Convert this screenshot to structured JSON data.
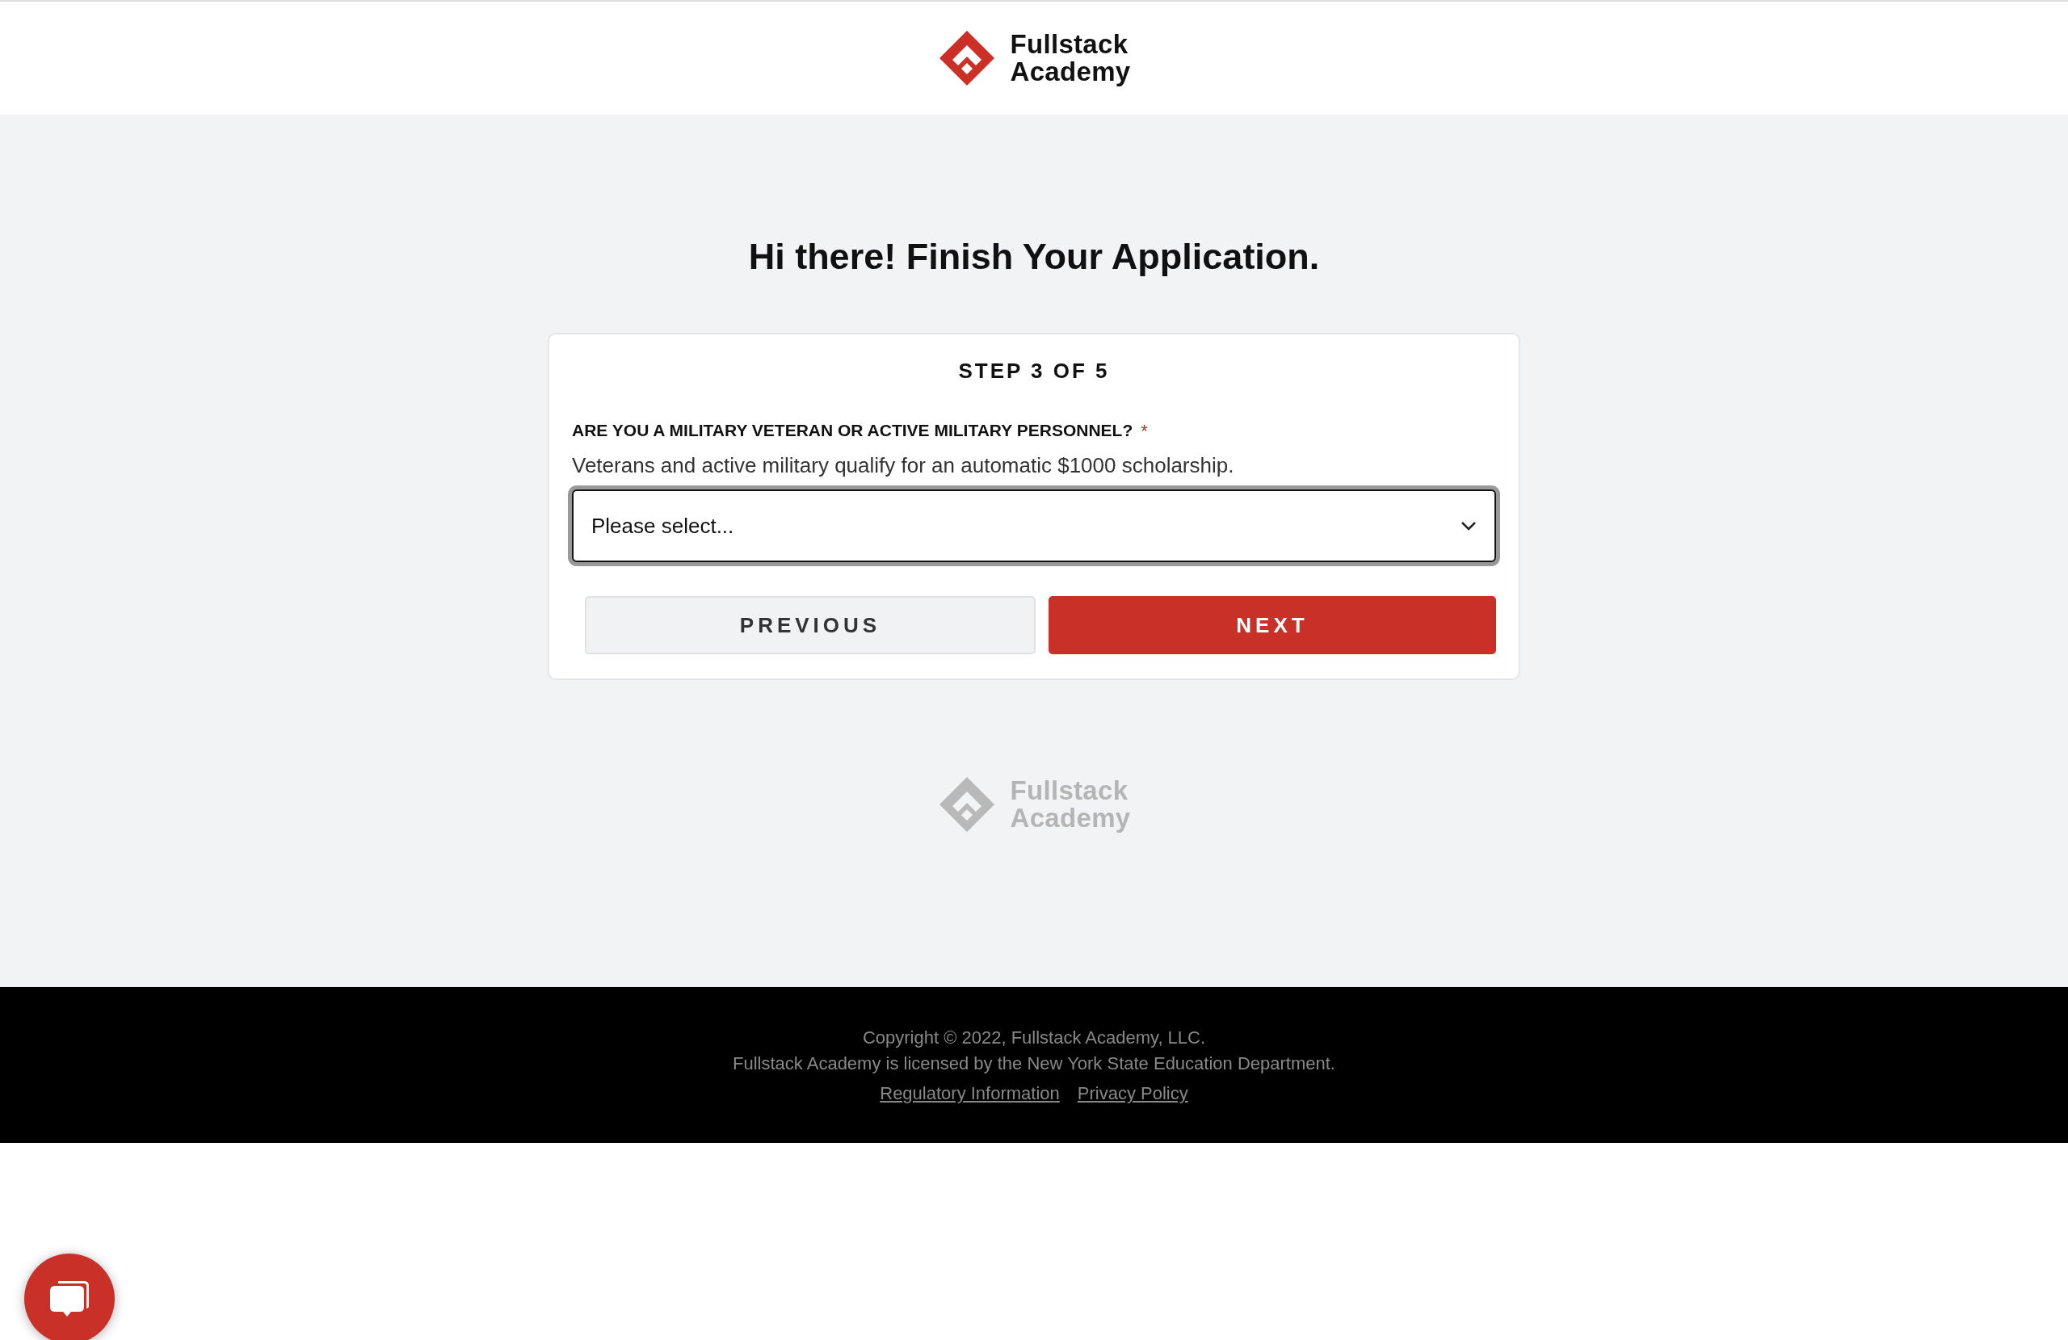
{
  "header": {
    "logo": [
      "Fullstack",
      "Academy"
    ]
  },
  "heading": "Hi there! Finish Your Application.",
  "card": {
    "step": "STEP 3 OF 5",
    "question": {
      "label": "ARE YOU A MILITARY VETERAN OR ACTIVE MILITARY PERSONNEL?",
      "required_mark": "*",
      "help": "Veterans and active military qualify for an automatic $1000 scholarship.",
      "select": {
        "placeholder": "Please select..."
      }
    },
    "buttons": [
      {
        "label": "PREVIOUS",
        "kind": "secondary"
      },
      {
        "label": "NEXT",
        "kind": "primary"
      }
    ]
  },
  "bottom_logo": [
    "Fullstack",
    "Academy"
  ],
  "footer": {
    "lines": [
      "Copyright © 2022, Fullstack Academy, LLC.",
      "Fullstack Academy is licensed by the New York State Education Department."
    ],
    "links": [
      "Regulatory Information",
      "Privacy Policy"
    ]
  }
}
